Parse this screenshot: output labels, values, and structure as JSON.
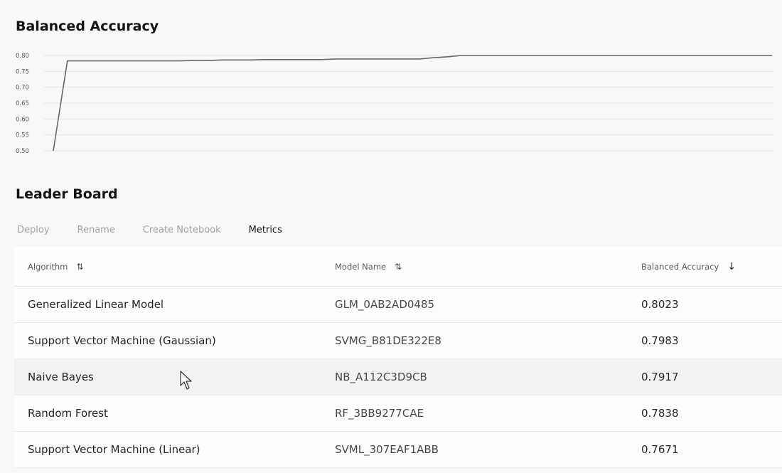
{
  "chart_title": "Balanced Accuracy",
  "chart_data": {
    "type": "line",
    "title": "Balanced Accuracy",
    "xlabel": "",
    "ylabel": "",
    "ylim": [
      0.5,
      0.8
    ],
    "y_ticks": [
      "0.80",
      "0.75",
      "0.70",
      "0.65",
      "0.60",
      "0.55",
      "0.50"
    ],
    "grid": true,
    "line_color": "#666666",
    "series": [
      {
        "values": [
          0.5,
          0.783,
          0.783,
          0.783,
          0.783,
          0.783,
          0.783,
          0.783,
          0.783,
          0.783,
          0.784,
          0.784,
          0.786,
          0.786,
          0.786,
          0.787,
          0.787,
          0.787,
          0.787,
          0.787,
          0.789,
          0.789,
          0.789,
          0.789,
          0.789,
          0.789,
          0.789,
          0.793,
          0.796,
          0.8,
          0.8,
          0.8,
          0.8,
          0.8,
          0.8,
          0.8,
          0.8,
          0.8,
          0.8,
          0.8,
          0.8,
          0.8,
          0.8,
          0.8,
          0.8,
          0.8,
          0.8,
          0.8,
          0.8,
          0.8,
          0.8,
          0.8
        ]
      }
    ]
  },
  "leaderboard": {
    "title": "Leader Board",
    "toolbar": {
      "deploy": "Deploy",
      "rename": "Rename",
      "create_notebook": "Create Notebook",
      "metrics": "Metrics"
    },
    "columns": {
      "algorithm": "Algorithm",
      "model_name": "Model Name",
      "balanced_accuracy": "Balanced Accuracy",
      "sort_both_icon": "⇅",
      "sort_desc_icon": "↓"
    },
    "rows": [
      {
        "algorithm": "Generalized Linear Model",
        "model_name": "GLM_0AB2AD0485",
        "balanced_accuracy": "0.8023"
      },
      {
        "algorithm": "Support Vector Machine (Gaussian)",
        "model_name": "SVMG_B81DE322E8",
        "balanced_accuracy": "0.7983"
      },
      {
        "algorithm": "Naive Bayes",
        "model_name": "NB_A112C3D9CB",
        "balanced_accuracy": "0.7917"
      },
      {
        "algorithm": "Random Forest",
        "model_name": "RF_3BB9277CAE",
        "balanced_accuracy": "0.7838"
      },
      {
        "algorithm": "Support Vector Machine (Linear)",
        "model_name": "SVML_307EAF1ABB",
        "balanced_accuracy": "0.7671"
      }
    ]
  }
}
